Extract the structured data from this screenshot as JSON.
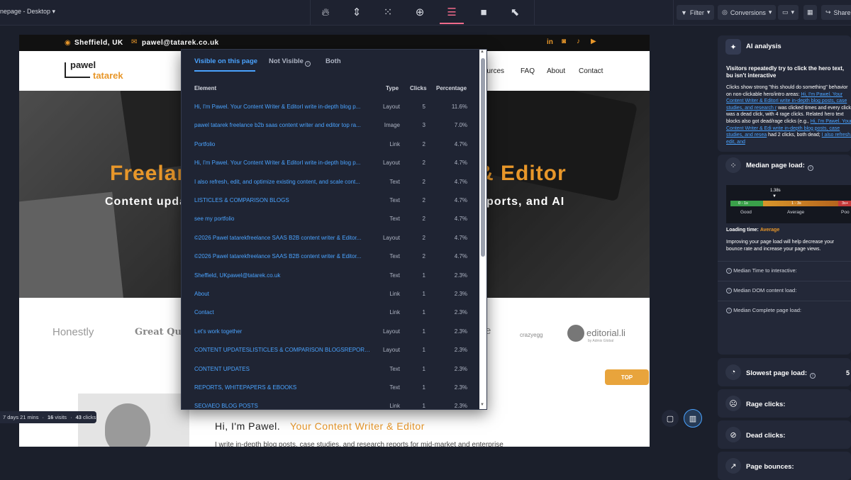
{
  "topbar": {
    "page_select": "nepage - Desktop",
    "filter": "Filter",
    "conversions": "Conversions",
    "share": "Share",
    "tools": [
      "flame-icon",
      "scroll-icon",
      "grid-icon",
      "plus-circle-icon",
      "list-icon",
      "video-icon",
      "cursor-click-icon"
    ]
  },
  "site": {
    "location": "Sheffield, UK",
    "email": "pawel@tatarek.co.uk",
    "logo_line1": "pawel",
    "logo_line2": "tatarek",
    "nav": [
      "ources",
      "FAQ",
      "About",
      "Contact"
    ],
    "hero_title_left": "Freelan",
    "hero_title_right": "& Editor",
    "hero_sub_left": "Content upda",
    "hero_sub_right": "ports, and AI",
    "logos": [
      "Honestly",
      "Great Que",
      "e",
      "crazyegg",
      "editorial.li"
    ],
    "logo_byline": "by Admix Global",
    "top_button": "TOP",
    "about_heading_a": "Hi, I'm Pawel.",
    "about_heading_b": "Your Content Writer & Editor",
    "about_text": "I write in-depth blog posts, case studies, and research reports for mid-market and enterprise"
  },
  "popup": {
    "tabs": [
      "Visible on this page",
      "Not Visible",
      "Both"
    ],
    "headers": {
      "element": "Element",
      "type": "Type",
      "clicks": "Clicks",
      "percentage": "Percentage"
    },
    "rows": [
      {
        "element": "Hi, I'm Pawel. Your Content Writer & EditorI write in-depth blog p...",
        "type": "Layout",
        "clicks": "5",
        "pct": "11.6%"
      },
      {
        "element": "pawel tatarek freelance b2b saas content writer and editor top ra...",
        "type": "Image",
        "clicks": "3",
        "pct": "7.0%"
      },
      {
        "element": "Portfolio",
        "type": "Link",
        "clicks": "2",
        "pct": "4.7%"
      },
      {
        "element": "Hi, I'm Pawel. Your Content Writer & EditorI write in-depth blog p...",
        "type": "Layout",
        "clicks": "2",
        "pct": "4.7%"
      },
      {
        "element": "I also refresh, edit, and optimize existing content, and scale cont...",
        "type": "Text",
        "clicks": "2",
        "pct": "4.7%"
      },
      {
        "element": "LISTICLES & COMPARISON BLOGS",
        "type": "Text",
        "clicks": "2",
        "pct": "4.7%"
      },
      {
        "element": "see my portfolio",
        "type": "Text",
        "clicks": "2",
        "pct": "4.7%"
      },
      {
        "element": "©2026 Pawel tatarekfreelance SAAS B2B content writer & Editor...",
        "type": "Layout",
        "clicks": "2",
        "pct": "4.7%"
      },
      {
        "element": "©2026 Pawel tatarekfreelance SAAS B2B content writer & Editor...",
        "type": "Text",
        "clicks": "2",
        "pct": "4.7%"
      },
      {
        "element": "Sheffield, UKpawel@tatarek.co.uk",
        "type": "Text",
        "clicks": "1",
        "pct": "2.3%"
      },
      {
        "element": "About",
        "type": "Link",
        "clicks": "1",
        "pct": "2.3%"
      },
      {
        "element": "Contact",
        "type": "Link",
        "clicks": "1",
        "pct": "2.3%"
      },
      {
        "element": "Let's work together",
        "type": "Layout",
        "clicks": "1",
        "pct": "2.3%"
      },
      {
        "element": "CONTENT UPDATESLISTICLES & COMPARISON BLOGSREPORT...",
        "type": "Layout",
        "clicks": "1",
        "pct": "2.3%"
      },
      {
        "element": "CONTENT UPDATES",
        "type": "Text",
        "clicks": "1",
        "pct": "2.3%"
      },
      {
        "element": "REPORTS, WHITEPAPERS & EBOOKS",
        "type": "Text",
        "clicks": "1",
        "pct": "2.3%"
      },
      {
        "element": "SEO/AEO BLOG POSTS",
        "type": "Link",
        "clicks": "1",
        "pct": "2.3%"
      }
    ]
  },
  "ai": {
    "title": "AI analysis",
    "headline": "Visitors repeatedly try to click the hero text, bu isn't interactive",
    "body_1": "Clicks show strong \"this should do something\" behavior on non-clickable hero/intro areas:",
    "link_1": "Hi, I'm Pawel. Your Content Writer & EditorI write in-depth blog posts, case studies, and research r",
    "body_2": "was clicked times and every click was a dead click, with 4 rage clicks. Related hero text blocks also got dead/rage clicks (e.g.,",
    "link_2": "Hi, I'm Pawel. Your Content Writer & Edi write in-depth blog posts, case studies, and resea",
    "body_3": "had 2 clicks, both dead;",
    "link_3": "I also refresh, edit, and"
  },
  "load": {
    "title": "Median page load:",
    "marker": "1.38s",
    "segments": [
      {
        "range": "0 - 1s",
        "label": "Good",
        "color": "#3aa04a"
      },
      {
        "range": "1 - 3s",
        "label": "Average",
        "color": "#d9962b"
      },
      {
        "range": "3s+",
        "label": "Poo",
        "color": "#c43a3a"
      }
    ],
    "loading_time_label": "Loading time:",
    "loading_time_value": "Average",
    "advice": "Improving your page load will help decrease your bounce rate and increase your page views.",
    "metrics": [
      "Median Time to interactive:",
      "Median DOM content load:",
      "Median Complete page load:"
    ]
  },
  "cards": {
    "slowest": "Slowest page load:",
    "slowest_value": "5",
    "rage": "Rage clicks:",
    "dead": "Dead clicks:",
    "bounces": "Page bounces:"
  },
  "footer": {
    "duration": "7 days 21 mins",
    "visits_n": "16",
    "visits_label": "visits",
    "clicks_n": "43",
    "clicks_label": "clicks"
  },
  "colors": {
    "accent": "#4aa3ff",
    "brand_orange": "#e8972a",
    "active_tool": "#f06a8a"
  }
}
